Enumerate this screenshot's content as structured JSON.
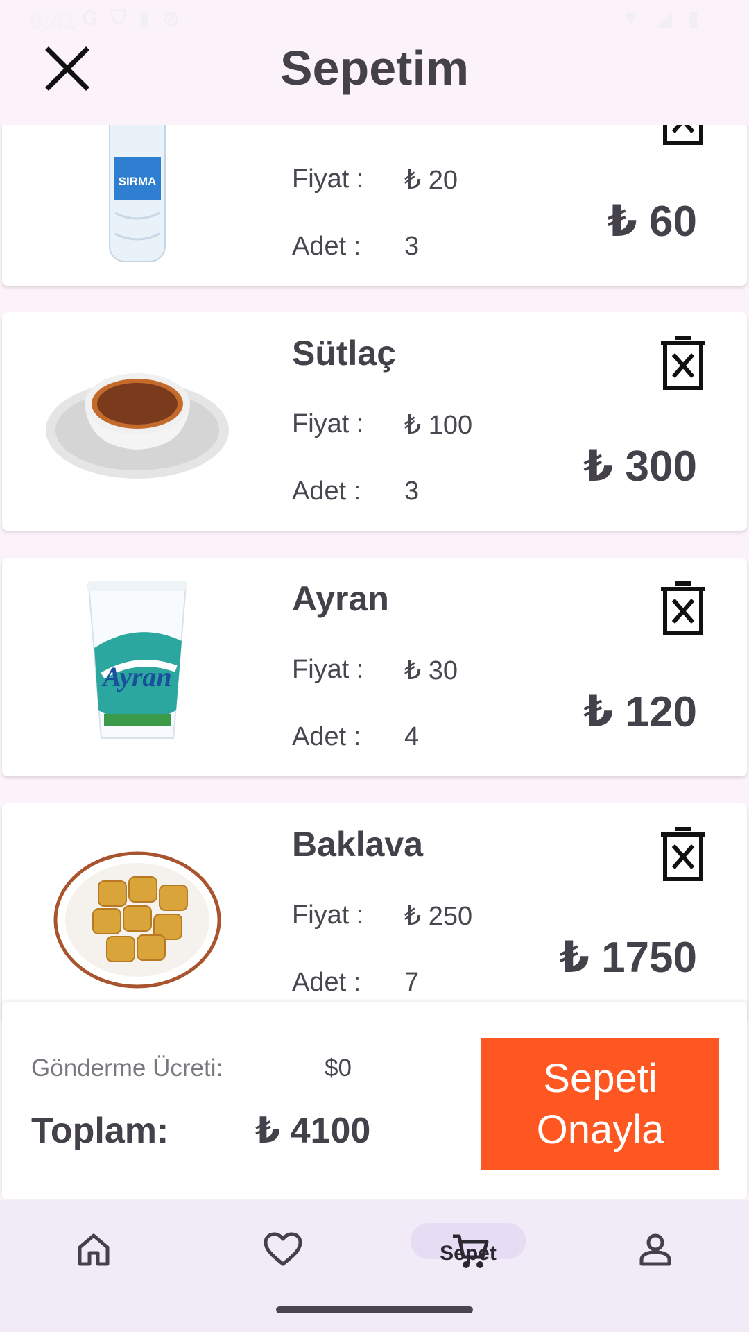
{
  "status_bar": {
    "time": "9:41",
    "carrier_glyph": "G"
  },
  "header": {
    "title": "Sepetim",
    "close_icon": "close-icon"
  },
  "labels": {
    "price": "Fiyat :",
    "quantity": "Adet :"
  },
  "items": [
    {
      "name": "",
      "price": "₺ 20",
      "quantity": "3",
      "line_total": "₺ 60",
      "image": "water-bottle"
    },
    {
      "name": "Sütlaç",
      "price": "₺ 100",
      "quantity": "3",
      "line_total": "₺ 300",
      "image": "rice-pudding"
    },
    {
      "name": "Ayran",
      "price": "₺ 30",
      "quantity": "4",
      "line_total": "₺ 120",
      "image": "ayran-cup"
    },
    {
      "name": "Baklava",
      "price": "₺ 250",
      "quantity": "7",
      "line_total": "₺ 1750",
      "image": "baklava-plate"
    }
  ],
  "summary": {
    "shipping_label": "Gönderme Ücreti:",
    "shipping_value": "$0",
    "total_label": "Toplam:",
    "total_value": "₺ 4100",
    "confirm_button": "Sepeti\nOnayla"
  },
  "nav": {
    "active": "cart",
    "cart_label": "Sepet",
    "items": [
      "home-icon",
      "heart-icon",
      "cart-icon",
      "profile-icon"
    ]
  },
  "colors": {
    "accent": "#ff5722",
    "background": "#fbf3f9",
    "nav_background": "#f1eaf7",
    "nav_active_pill": "#e6ddf4"
  }
}
